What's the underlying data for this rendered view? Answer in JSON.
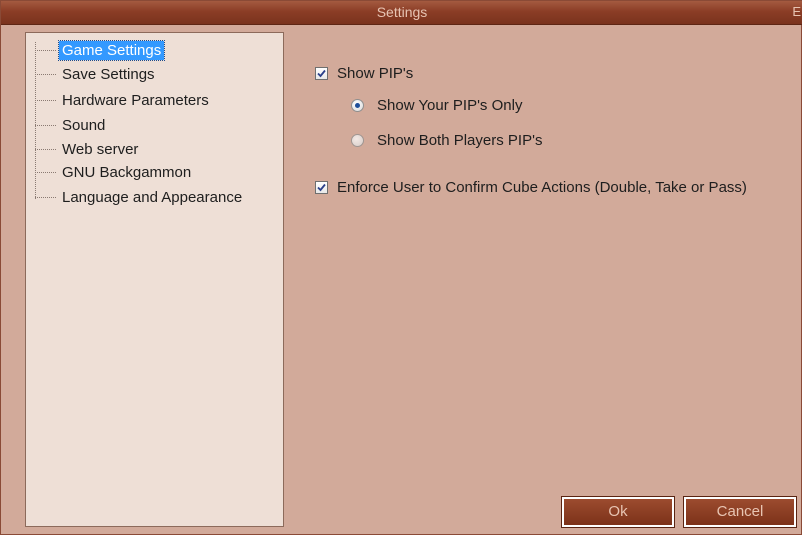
{
  "window": {
    "title": "Settings",
    "close_glyph": "E"
  },
  "tree": {
    "items": [
      {
        "label": "Game Settings",
        "selected": true
      },
      {
        "label": "Save Settings",
        "selected": false
      },
      {
        "label": "Hardware Parameters",
        "selected": false
      },
      {
        "label": "Sound",
        "selected": false
      },
      {
        "label": "Web server",
        "selected": false
      },
      {
        "label": "GNU Backgammon",
        "selected": false
      },
      {
        "label": "Language and Appearance",
        "selected": false
      }
    ]
  },
  "game_settings": {
    "show_pips": {
      "label": "Show PIP's",
      "checked": true
    },
    "pip_mode": {
      "options": [
        {
          "label": "Show Your PIP's Only",
          "selected": true
        },
        {
          "label": "Show Both Players PIP's",
          "selected": false
        }
      ]
    },
    "enforce_confirm": {
      "label": "Enforce User to Confirm Cube Actions (Double, Take or Pass)",
      "checked": true
    }
  },
  "buttons": {
    "ok_label": "Ok",
    "cancel_label": "Cancel"
  },
  "colors": {
    "window_bg": "#d2aa9a",
    "titlebar": "#8b3d26",
    "tree_bg": "#eedfd6",
    "selection": "#3399ff",
    "button_bg": "#8a3c22",
    "button_text": "#e8c4b2"
  },
  "icons": {
    "checkbox_checked": "checkmark-icon",
    "radio_selected": "radio-dot-icon"
  }
}
